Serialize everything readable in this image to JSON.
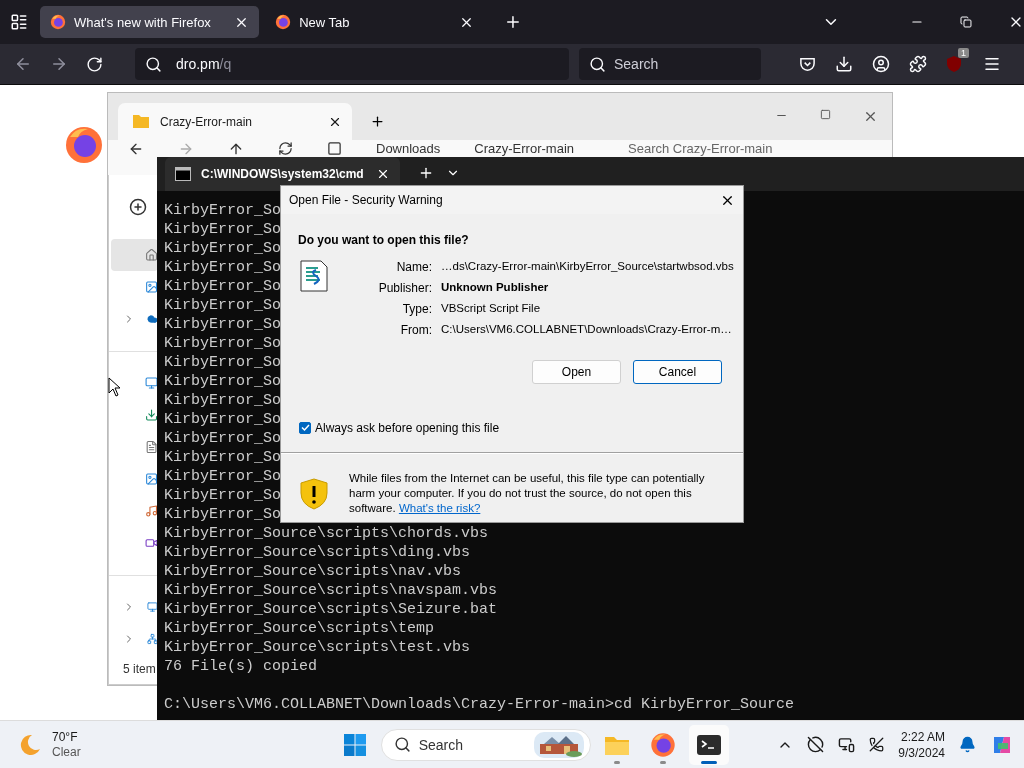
{
  "browser": {
    "tabs": [
      {
        "title": "What's new with Firefox",
        "selected": true
      },
      {
        "title": "New Tab",
        "selected": false
      }
    ],
    "url": {
      "host": "dro.pm",
      "path": "/q"
    },
    "search": {
      "placeholder": "Search"
    },
    "extension_badge": "1"
  },
  "explorer": {
    "tab": "Crazy-Error-main",
    "breadcrumbs": [
      "Downloads",
      "Crazy-Error-main"
    ],
    "search": {
      "placeholder": "Search Crazy-Error-main"
    },
    "sidebar": [
      {
        "kind": "home",
        "selected": true,
        "chevron": false
      },
      {
        "kind": "gallery",
        "selected": false,
        "chevron": false
      },
      {
        "kind": "cloud",
        "selected": false,
        "chevron": true
      },
      {
        "kind": "divider"
      },
      {
        "kind": "desktop",
        "selected": false,
        "chevron": false
      },
      {
        "kind": "downloads",
        "selected": false,
        "chevron": false
      },
      {
        "kind": "documents",
        "selected": false,
        "chevron": false
      },
      {
        "kind": "pictures",
        "selected": false,
        "chevron": false
      },
      {
        "kind": "music",
        "selected": false,
        "chevron": false
      },
      {
        "kind": "videos",
        "selected": false,
        "chevron": false
      },
      {
        "kind": "divider"
      },
      {
        "kind": "pc",
        "selected": false,
        "chevron": true
      },
      {
        "kind": "network",
        "selected": false,
        "chevron": true
      }
    ],
    "status": "5 item"
  },
  "terminal": {
    "tab": "C:\\WINDOWS\\system32\\cmd",
    "lines": [
      "KirbyError_So",
      "KirbyError_So",
      "KirbyError_So",
      "KirbyError_So",
      "KirbyError_So",
      "KirbyError_So",
      "KirbyError_So",
      "KirbyError_So",
      "KirbyError_So",
      "KirbyError_So",
      "KirbyError_So",
      "KirbyError_So",
      "KirbyError_So",
      "KirbyError_So",
      "KirbyError_So",
      "KirbyError_So",
      "KirbyError_So",
      "KirbyError_Source\\scripts\\chords.vbs",
      "KirbyError_Source\\scripts\\ding.vbs",
      "KirbyError_Source\\scripts\\nav.vbs",
      "KirbyError_Source\\scripts\\navspam.vbs",
      "KirbyError_Source\\scripts\\Seizure.bat",
      "KirbyError_Source\\scripts\\temp",
      "KirbyError_Source\\scripts\\test.vbs",
      "76 File(s) copied"
    ],
    "prompt": "C:\\Users\\VM6.COLLABNET\\Downloads\\Crazy-Error-main>cd KirbyError_Source"
  },
  "dialog": {
    "title": "Open File - Security Warning",
    "question": "Do you want to open this file?",
    "fields": [
      {
        "label": "Name:",
        "value": "…ds\\Crazy-Error-main\\KirbyError_Source\\startwbsod.vbs",
        "bold": false
      },
      {
        "label": "Publisher:",
        "value": "Unknown Publisher",
        "bold": true
      },
      {
        "label": "Type:",
        "value": "VBScript Script File",
        "bold": false
      },
      {
        "label": "From:",
        "value": "C:\\Users\\VM6.COLLABNET\\Downloads\\Crazy-Error-m…",
        "bold": false
      }
    ],
    "buttons": [
      {
        "label": "Open",
        "default": false
      },
      {
        "label": "Cancel",
        "default": true
      }
    ],
    "checkbox": {
      "label": "Always ask before opening this file",
      "checked": true
    },
    "warning": {
      "text": "While files from the Internet can be useful, this file type can potentially harm your computer. If you do not trust the source, do not open this software.",
      "link": "What's the risk?"
    }
  },
  "taskbar": {
    "weather": {
      "temp": "70°F",
      "condition": "Clear"
    },
    "search": {
      "placeholder": "Search"
    },
    "apps": [
      {
        "kind": "explorer",
        "active": false
      },
      {
        "kind": "firefox",
        "active": false
      },
      {
        "kind": "terminal",
        "active": true
      }
    ],
    "time": "2:22 AM",
    "date": "9/3/2024"
  }
}
